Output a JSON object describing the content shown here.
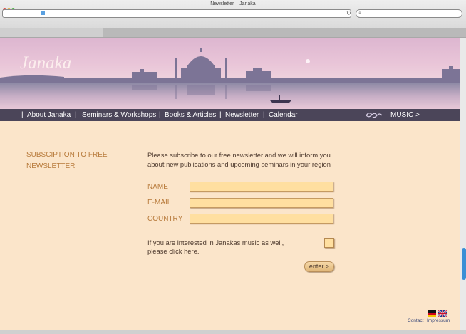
{
  "browser": {
    "window_title": "Newsletter – Janaka",
    "url_text": "",
    "search_placeholder": "",
    "bookmarks": [
      "",
      "",
      "",
      "",
      "",
      "",
      "",
      "",
      "",
      ""
    ]
  },
  "site": {
    "logo_text": "Janaka",
    "nav": {
      "items": [
        {
          "label": "About Janaka"
        },
        {
          "label": "Seminars  & Workshops"
        },
        {
          "label": "Books  & Articles"
        },
        {
          "label": "Newsletter"
        },
        {
          "label": "Calendar"
        }
      ],
      "separator": "|",
      "music_label": "MUSIC >"
    }
  },
  "form": {
    "heading_line1": "SUBSCIPTION TO FREE",
    "heading_line2": "NEWSLETTER",
    "intro_line1": "Please subscribe to our free newsletter and we will inform you",
    "intro_line2": "about new publications and upcoming seminars in your region",
    "fields": {
      "name_label": "NAME",
      "email_label": "E-MAIL",
      "country_label": "COUNTRY",
      "name_value": "",
      "email_value": "",
      "country_value": ""
    },
    "music_line1": "If you are interested in Janakas music as well,",
    "music_line2": "please click here.",
    "submit_label": "enter >"
  },
  "footer": {
    "contact_label": "Contact",
    "impressum_label": "Impressum"
  },
  "colors": {
    "page_bg": "#fbe5ca",
    "nav_bg": "#4b4559",
    "label_color": "#b87b3c",
    "input_bg": "#ffdfa0"
  },
  "icons": [
    "om-icon",
    "german-flag-icon",
    "english-flag-icon"
  ]
}
